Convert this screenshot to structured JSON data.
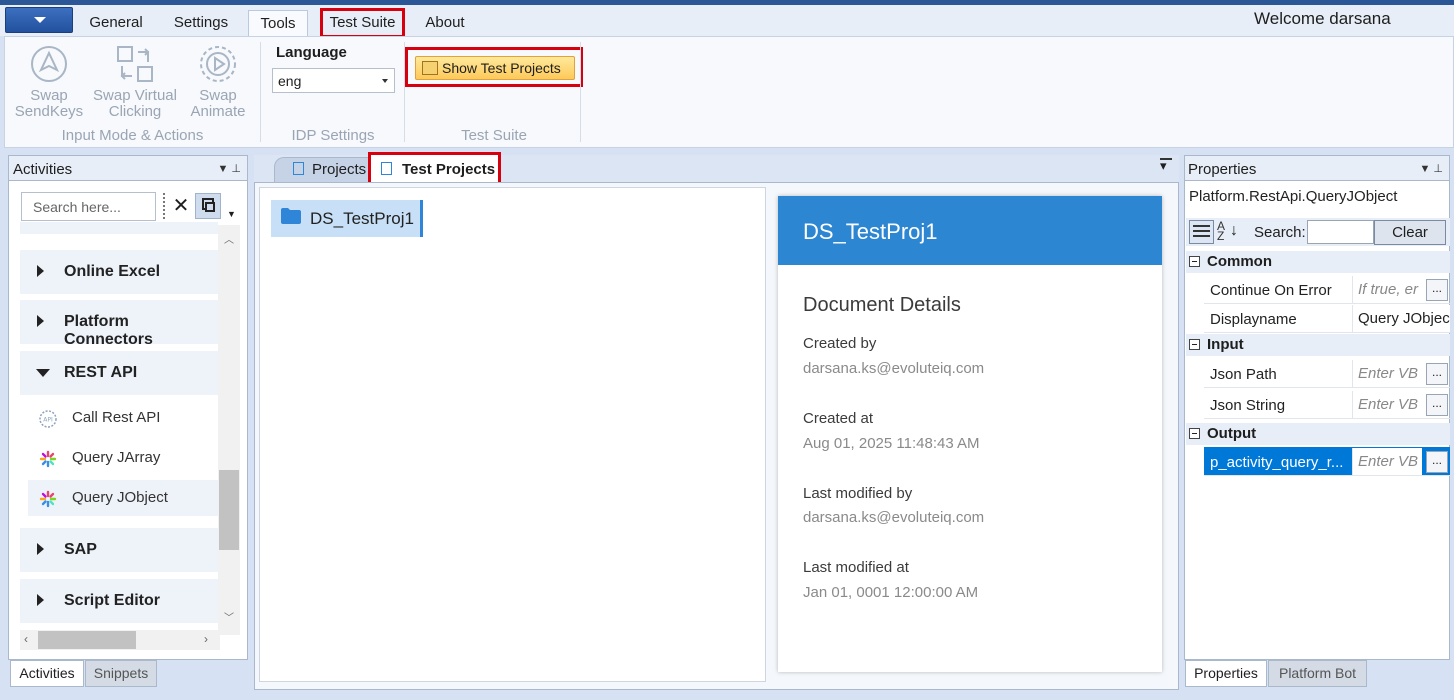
{
  "ribbon": {
    "tabs": [
      "General",
      "Settings",
      "Tools",
      "Test Suite",
      "About"
    ],
    "active_tab": "Tools",
    "welcome": "Welcome  darsana",
    "input_mode": {
      "swap_sendkeys": [
        "Swap",
        "SendKeys"
      ],
      "swap_virtual": [
        "Swap Virtual",
        "Clicking"
      ],
      "swap_animate": [
        "Swap",
        "Animate"
      ],
      "group_label": "Input Mode & Actions"
    },
    "idp": {
      "language_label": "Language",
      "language_value": "eng",
      "group_label": "IDP Settings"
    },
    "test_suite": {
      "button_label": "Show Test Projects",
      "group_label": "Test Suite"
    }
  },
  "activities": {
    "title": "Activities",
    "search_placeholder": "Search here...",
    "categories": [
      "Online Excel",
      "Platform Connectors",
      "REST API",
      "SAP",
      "Script Editor"
    ],
    "rest_items": [
      "Call Rest API",
      "Query JArray",
      "Query JObject"
    ],
    "bottom_tabs": [
      "Activities",
      "Snippets"
    ]
  },
  "doc": {
    "tabs": [
      "Projects",
      "Test Projects"
    ],
    "project_name": "DS_TestProj1",
    "detail": {
      "header": "DS_TestProj1",
      "section_title": "Document Details",
      "created_by_label": "Created by",
      "created_by": "darsana.ks@evoluteiq.com",
      "created_at_label": "Created at",
      "created_at": "Aug 01, 2025 11:48:43 AM",
      "modified_by_label": "Last modified by",
      "modified_by": "darsana.ks@evoluteiq.com",
      "modified_at_label": "Last modified at",
      "modified_at": "Jan 01, 0001 12:00:00 AM"
    }
  },
  "properties": {
    "title": "Properties",
    "type_name": "Platform.RestApi.QueryJObject",
    "search_label": "Search:",
    "clear_label": "Clear",
    "sections": {
      "common": "Common",
      "input": "Input",
      "output": "Output"
    },
    "rows": {
      "continue_on_error": {
        "name": "Continue On Error",
        "value": "If true, er"
      },
      "displayname": {
        "name": "Displayname",
        "value": "Query JObject"
      },
      "json_path": {
        "name": "Json Path",
        "value": "Enter VB"
      },
      "json_string": {
        "name": "Json String",
        "value": "Enter VB"
      },
      "output_row": {
        "name": "p_activity_query_r...",
        "value": "Enter VB"
      }
    },
    "dots": "...",
    "bottom_tabs": [
      "Properties",
      "Platform Bot"
    ]
  }
}
